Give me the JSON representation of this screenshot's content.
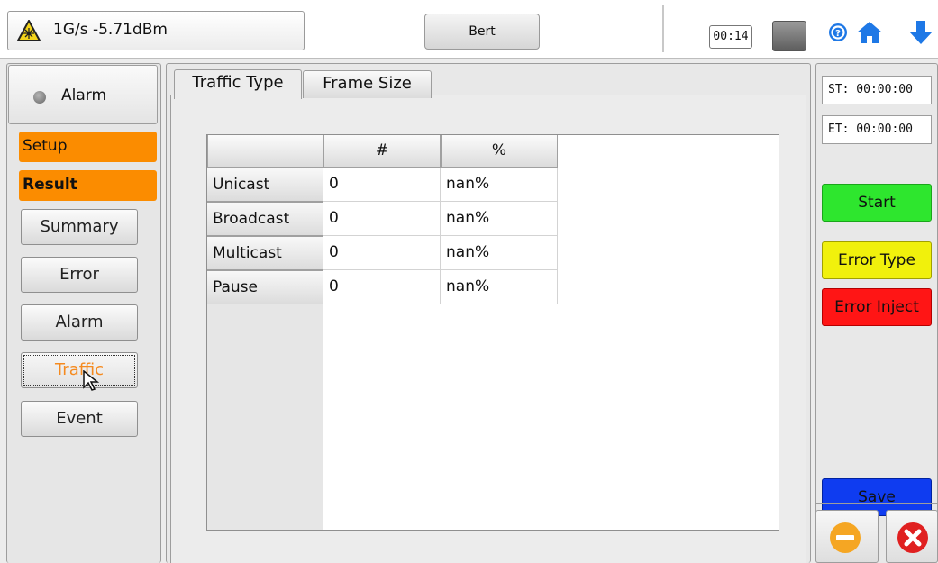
{
  "topbar": {
    "laser_status": "1G/s -5.71dBm",
    "mode_button": "Bert",
    "timer": "00:14"
  },
  "sidebar": {
    "alarm_label": "Alarm",
    "setup_label": "Setup",
    "result_label": "Result",
    "nav": [
      "Summary",
      "Error",
      "Alarm",
      "Traffic",
      "Event"
    ]
  },
  "tabs": [
    "Traffic Type",
    "Frame Size"
  ],
  "table": {
    "columns": [
      "#",
      "%"
    ],
    "rows": [
      {
        "label": "Unicast",
        "count": "0",
        "percent": "nan%"
      },
      {
        "label": "Broadcast",
        "count": "0",
        "percent": "nan%"
      },
      {
        "label": "Multicast",
        "count": "0",
        "percent": "nan%"
      },
      {
        "label": "Pause",
        "count": "0",
        "percent": "nan%"
      }
    ]
  },
  "right": {
    "start_time": "ST: 00:00:00",
    "end_time": "ET: 00:00:00",
    "start": "Start",
    "error_type": "Error Type",
    "error_inject": "Error Inject",
    "save": "Save"
  },
  "colors": {
    "orange": "#fb8c00",
    "start": "#2ee62e",
    "error_type": "#f1f10c",
    "error_inject": "#ff1515",
    "save": "#0f3cf0",
    "icon_blue": "#1e78e6",
    "active_nav_text": "#f58a1f"
  },
  "icons": [
    "laser-warning-icon",
    "battery-icon",
    "help-icon",
    "home-icon",
    "download-arrow-icon",
    "minimize-icon",
    "close-icon",
    "mouse-cursor-icon",
    "alarm-led-icon"
  ]
}
